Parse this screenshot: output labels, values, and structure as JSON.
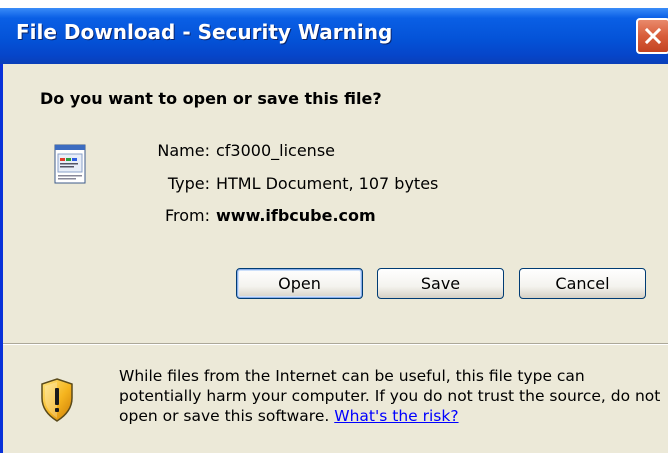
{
  "window": {
    "title": "File Download - Security Warning"
  },
  "dialog": {
    "question": "Do you want to open or save this file?",
    "file": {
      "name_label": "Name:",
      "name_value": "cf3000_license",
      "type_label": "Type:",
      "type_value": "HTML Document, 107 bytes",
      "from_label": "From:",
      "from_value": "www.ifbcube.com",
      "icon": "html-document-icon"
    },
    "buttons": {
      "open": "Open",
      "save": "Save",
      "cancel": "Cancel"
    },
    "warning": {
      "icon": "security-shield-icon",
      "line1": "While files from the Internet can be useful, this file type can",
      "line2": "potentially harm your computer. If you do not trust the source, do not",
      "line3": "open or save this software.",
      "link": "What's the risk?"
    }
  },
  "colors": {
    "titlebar": "#0453d8",
    "dialog_bg": "#ece9d8",
    "link": "#0000ff",
    "close_button": "#d85d3a"
  }
}
